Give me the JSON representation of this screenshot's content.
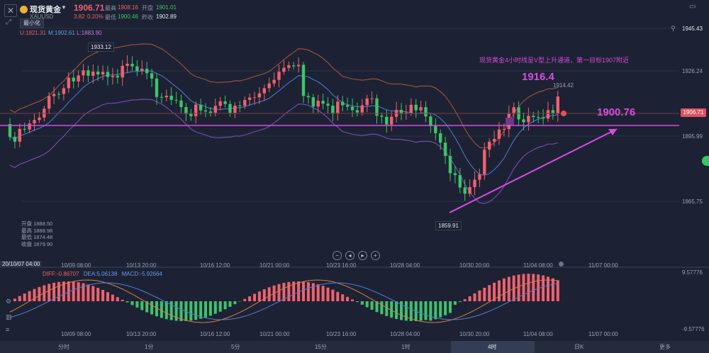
{
  "header": {
    "title": "现货黄金",
    "symbol": "XAUUSD",
    "price": "1906.71",
    "change": "3.82",
    "change_pct": "0.20%",
    "high_label": "最高",
    "high_value": "1908.16",
    "low_label": "最低",
    "low_value": "1900.46",
    "open_label": "开盘",
    "open_value": "1901.01",
    "prev_label": "昨收",
    "prev_value": "1902.89",
    "minimize_label": "最小化"
  },
  "bollinger": {
    "u": "U:1921.31",
    "m": "M:1902.61",
    "l": "L:1883.90"
  },
  "yaxis": [
    "1945.43",
    "1926.24",
    "1895.99",
    "1865.75"
  ],
  "current_price_tag": "1906.71",
  "macd_axis": [
    "9.57776",
    "-9.57776"
  ],
  "annotation_text": "现货黄金4小时线呈V型上升通道，第一目标1907附近",
  "big_label_1": "1916.4",
  "big_label_2": "1900.76",
  "peak_label": "1933.12",
  "trough_label": "1859.91",
  "mini_label": "1914.42",
  "stats": {
    "open": "开盘 1888.50",
    "high": "最高 1888.98",
    "low": "最低 1874.48",
    "close": "收盘 1879.90"
  },
  "cursor_date": "20/10/07 04:00",
  "xaxis": [
    "10/09 08:00",
    "10/13 20:00",
    "10/16 12:00",
    "10/21 00:00",
    "10/23 16:00",
    "10/28 04:00",
    "10/30 20:00",
    "11/04 08:00",
    "11/07 00:00"
  ],
  "macd_legend": {
    "diff": "DIFF:-0.86707",
    "dea": "DEA:5.06138",
    "macd": "MACD:-5.92664"
  },
  "timeframes": [
    "分时",
    "1分",
    "5分",
    "15分",
    "1时",
    "4时",
    "日K",
    "更多"
  ],
  "active_timeframe": "4时",
  "colors": {
    "up": "#f0616d",
    "down": "#3ec36a",
    "trend": "#d64de0",
    "bg": "#1c2233"
  }
}
